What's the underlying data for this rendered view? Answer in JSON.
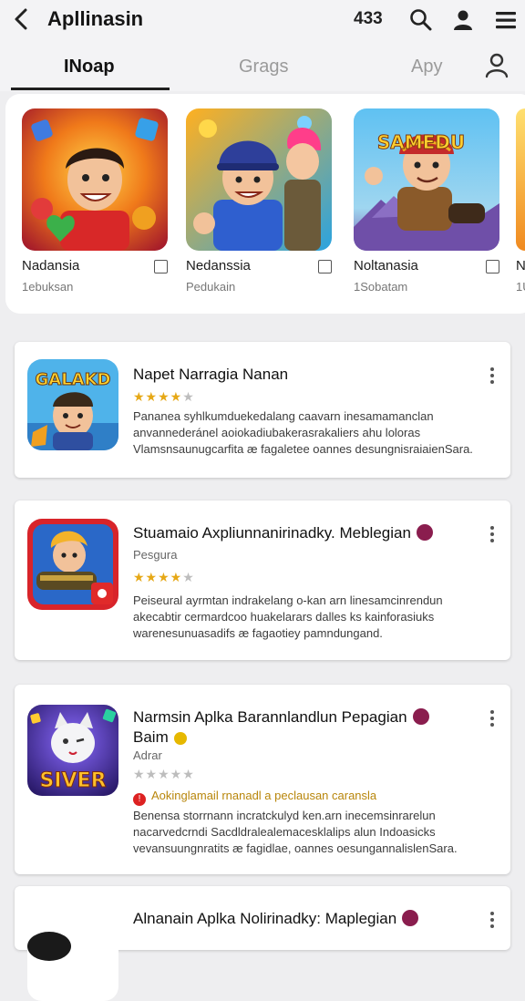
{
  "header": {
    "title": "Apllinasin",
    "count": "433",
    "back_icon": "chevron-left-icon",
    "icons": [
      "search-icon",
      "account-icon",
      "menu-icon"
    ]
  },
  "tabs": [
    {
      "label": "INoap",
      "active": true
    },
    {
      "label": "Grags",
      "active": false
    },
    {
      "label": "Apy",
      "active": false
    }
  ],
  "featured": [
    {
      "name": "Nadansia",
      "sub": "1ebuksan",
      "art": "cartoon-boy-red-shirt"
    },
    {
      "name": "Nedanssia",
      "sub": "Pedukain",
      "art": "helmet-boy-and-pink-hair-girl"
    },
    {
      "name": "Noltanasia",
      "sub": "1Sobatam",
      "art": "samedu-warrior-boy",
      "art_text": "SAMEDU"
    },
    {
      "name": "N",
      "sub": "1U",
      "art": "partial-card"
    }
  ],
  "cards": [
    {
      "title": "Napet Narragia Nanan",
      "sub": "",
      "rating": 4,
      "icon_text": "GALAKD",
      "desc": [
        "Pananea syhlkumduekedalang caavarn inesamamanclan",
        "anvannederánel aoiokadiubakerasrakaliers ahu loloras",
        "Vlamsnsaunugcarfita æ fagaletee oannes desungnisraiaienSara."
      ],
      "warning": ""
    },
    {
      "title": "Stuamaio Axpliunnanirinadky. Meblegian",
      "sub": "Pesgura",
      "rating": 4,
      "icon_text": "",
      "desc": [
        "Peiseural ayrmtan indrakelang o-kan arn linesamcinrendun",
        "akecabtir cermardcoo huakelarars dalles ks kainforasiuks",
        "warenesunuasadifs æ fagaotiey pamndungand."
      ],
      "warning": ""
    },
    {
      "title": "Narmsin Aplka Barannlandlun Pepagian",
      "title2": "Baim",
      "sub": "Adrar",
      "rating": 0,
      "icon_text": "SIVER",
      "warning": "Aokinglamail rnanadl a peclausan caransla",
      "desc": [
        "Benensa storrnann incratckulyd ken.arn inecemsinrarelun",
        "nacarvedcrndi Sacdldralealemacesklalips alun Indoasicks",
        "vevansuungnratits æ fagidlae, oannes oesungannalislenSara."
      ]
    },
    {
      "title": "Alnanain Aplka Nolirinadky: Maplegian",
      "sub": "",
      "rating": 0,
      "icon_text": "",
      "desc": [],
      "warning": ""
    }
  ],
  "colors": {
    "accent_star": "#e6a816",
    "badge": "#8a1d4e",
    "warning": "#b8860b"
  }
}
